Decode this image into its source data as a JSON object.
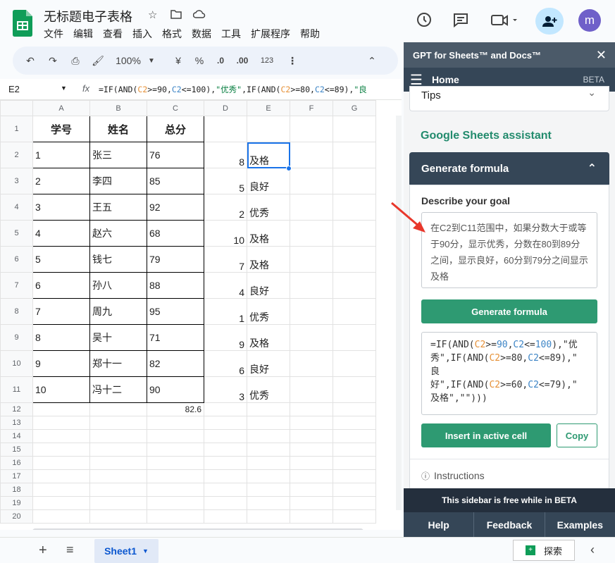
{
  "app": {
    "title": "无标题电子表格",
    "menu": [
      "文件",
      "编辑",
      "查看",
      "插入",
      "格式",
      "数据",
      "工具",
      "扩展程序",
      "帮助"
    ],
    "avatar_letter": "m"
  },
  "toolbar": {
    "zoom": "100%",
    "currency": "¥",
    "percent": "%",
    "dec_decrease": ".0",
    "dec_increase": ".00",
    "number_format": "123"
  },
  "formula_bar": {
    "cell_ref": "E2",
    "fx": "fx",
    "formula_parts": [
      "=IF(AND(",
      "C2",
      ">=90,",
      "C2",
      "<=100),",
      "\"优秀\"",
      ",IF(AND(",
      "C2",
      ">=80,",
      "C2",
      "<=89),",
      "\"良"
    ]
  },
  "sheet": {
    "columns": [
      "A",
      "B",
      "C",
      "D",
      "E",
      "F",
      "G"
    ],
    "rows": [
      "1",
      "2",
      "3",
      "4",
      "5",
      "6",
      "7",
      "8",
      "9",
      "10",
      "11",
      "12",
      "13",
      "14",
      "15",
      "16",
      "17",
      "18",
      "19",
      "20"
    ],
    "header_row": [
      "学号",
      "姓名",
      "总分"
    ],
    "data": [
      {
        "a": "1",
        "b": "张三",
        "c": "76",
        "d": "8",
        "e": "及格"
      },
      {
        "a": "2",
        "b": "李四",
        "c": "85",
        "d": "5",
        "e": "良好"
      },
      {
        "a": "3",
        "b": "王五",
        "c": "92",
        "d": "2",
        "e": "优秀"
      },
      {
        "a": "4",
        "b": "赵六",
        "c": "68",
        "d": "10",
        "e": "及格"
      },
      {
        "a": "5",
        "b": "钱七",
        "c": "79",
        "d": "7",
        "e": "及格"
      },
      {
        "a": "6",
        "b": "孙八",
        "c": "88",
        "d": "4",
        "e": "良好"
      },
      {
        "a": "7",
        "b": "周九",
        "c": "95",
        "d": "1",
        "e": "优秀"
      },
      {
        "a": "8",
        "b": "吴十",
        "c": "71",
        "d": "9",
        "e": "及格"
      },
      {
        "a": "9",
        "b": "郑十一",
        "c": "82",
        "d": "6",
        "e": "良好"
      },
      {
        "a": "10",
        "b": "冯十二",
        "c": "90",
        "d": "3",
        "e": "优秀"
      }
    ],
    "average": "82.6",
    "selected_cell": "E2"
  },
  "tabs": {
    "sheet_name": "Sheet1",
    "explore": "探索"
  },
  "sidebar": {
    "title": "GPT for Sheets™ and Docs™",
    "nav_home": "Home",
    "beta": "BETA",
    "tips": "Tips",
    "assistant_title": "Google Sheets assistant",
    "section_title": "Generate formula",
    "goal_label": "Describe your goal",
    "goal_text": "在C2到C11范围中，如果分数大于或等于90分，显示优秀，分数在80到89分之间，显示良好，60分到79分之间显示及格",
    "generate_label": "Generate formula",
    "result_lines": [
      [
        "=IF(AND(",
        "C2",
        ">=",
        "90",
        ",",
        "C2",
        "<=",
        "100",
        "),\"优"
      ],
      [
        "秀\",IF(AND(",
        "C2",
        ">=80,",
        "C2",
        "<=89),\""
      ],
      [
        "良"
      ],
      [
        "好\",IF(AND(",
        "C2",
        ">=60,",
        "C2",
        "<=79),\""
      ],
      [
        "及格\",\"\")))"
      ]
    ],
    "insert_label": "Insert in active cell",
    "copy_label": "Copy",
    "instructions": "Instructions",
    "footer_msg": "This sidebar is free while in BETA",
    "footer_nav": [
      "Help",
      "Feedback",
      "Examples"
    ]
  },
  "colors": {
    "accent_green": "#2e9a72",
    "sidebar_dark": "#354657",
    "selection_blue": "#1a73e8",
    "annotation_arrow": "#e8372b"
  }
}
